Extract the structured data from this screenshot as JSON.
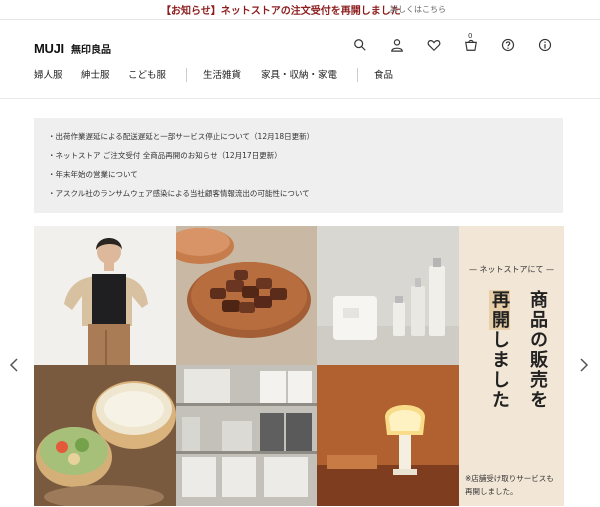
{
  "notice": {
    "text": "【お知らせ】ネットストアの注文受付を再開しました",
    "link": "詳しくはこちら"
  },
  "header": {
    "logo_en": "MUJI",
    "logo_jp": "無印良品",
    "cart_count": "0",
    "icons": [
      "search-icon",
      "user-icon",
      "heart-icon",
      "cart-icon",
      "help-icon",
      "info-icon"
    ]
  },
  "nav": {
    "items": [
      "婦人服",
      "紳士服",
      "こども服",
      "生活雑貨",
      "家具・収納・家電",
      "食品"
    ]
  },
  "news": {
    "items": [
      "出荷作業遅延による配送遅延と一部サービス停止について（12月18日更新）",
      "ネットストア ご注文受付 全商品再開のお知らせ（12月17日更新）",
      "年末年始の営業について",
      "アスクル社のランサムウェア感染による当社顧客情報流出の可能性について"
    ]
  },
  "hero": {
    "promo_sub": "ネットストアにて",
    "promo_col1_pre": "商品の",
    "promo_col1_post": "販売を",
    "promo_col2_hl": "再開",
    "promo_col2_post": "しました",
    "promo_note": "※店舗受け取りサービスも再開しました。"
  },
  "colors": {
    "notice_red": "#8c1d1d",
    "news_bg": "#efefef",
    "promo_bg": "#f2e6d6",
    "promo_highlight": "#e8cfa8"
  }
}
